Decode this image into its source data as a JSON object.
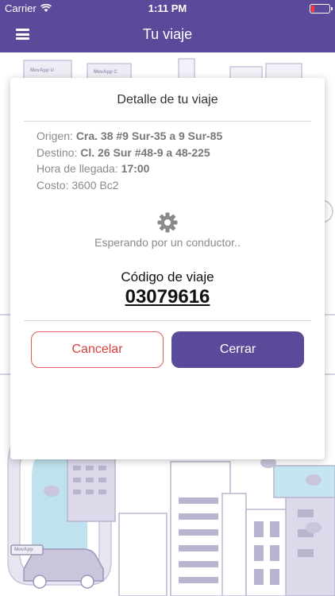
{
  "status_bar": {
    "carrier": "Carrier",
    "time": "1:11 PM"
  },
  "nav": {
    "title": "Tu viaje",
    "menu_icon": "hamburger-menu-icon"
  },
  "background": {
    "sign_1": "MovApp U",
    "sign_2": "MovApp C",
    "car_sign": "MovApp"
  },
  "card": {
    "title": "Detalle de tu viaje",
    "origin_label": "Origen:",
    "origin_value": "Cra. 38 #9 Sur-35 a 9 Sur-85",
    "destination_label": "Destino:",
    "destination_value": "Cl. 26 Sur #48-9 a 48-225",
    "arrival_label": "Hora de llegada:",
    "arrival_value": "17:00",
    "cost_label": "Costo:",
    "cost_value": "3600 Bc2",
    "status_icon": "gear-icon",
    "status_text": "Esperando por un conductor..",
    "code_label": "Código de viaje",
    "code_value": "03079616",
    "cancel_label": "Cancelar",
    "close_label": "Cerrar"
  },
  "colors": {
    "primary": "#5b4a9a",
    "cancel": "#d9403f",
    "text_muted": "#8a8a8a"
  }
}
